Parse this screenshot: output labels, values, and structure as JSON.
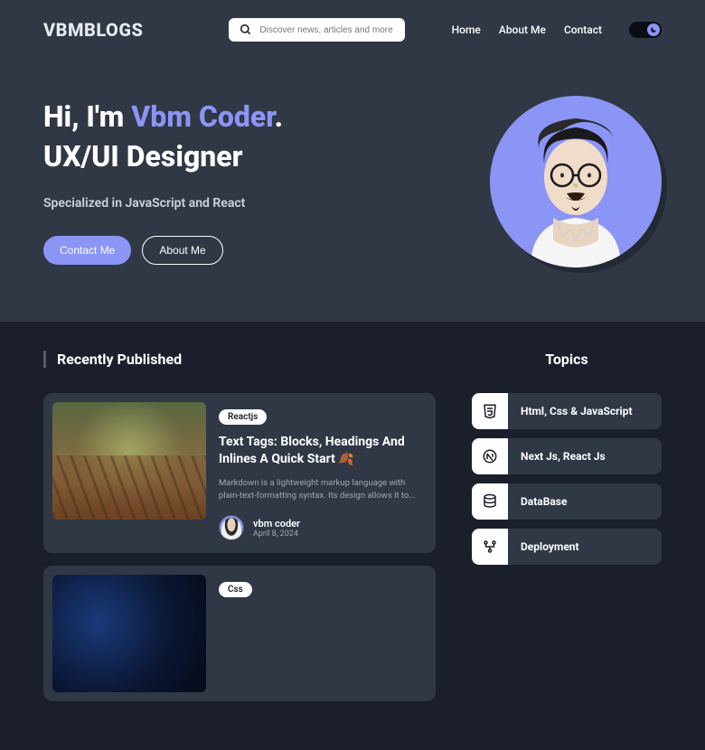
{
  "header": {
    "logo": "VBMBLOGS",
    "search_placeholder": "Discover news, articles and more",
    "nav": {
      "home": "Home",
      "about": "About Me",
      "contact": "Contact"
    }
  },
  "hero": {
    "greeting_prefix": "Hi, I'm ",
    "greeting_name": "Vbm Coder",
    "greeting_suffix": ".",
    "role": "UX/UI Designer",
    "subtitle": "Specialized in JavaScript and React",
    "btn_contact": "Contact Me",
    "btn_about": "About Me"
  },
  "sections": {
    "recently": "Recently Published",
    "topics": "Topics"
  },
  "posts": [
    {
      "tag": "Reactjs",
      "title": "Text Tags: Blocks, Headings And Inlines A Quick Start 🍂",
      "desc": "Markdown is a lightweight markup language with plain-text-formatting syntax. Its design allows it to...",
      "author": "vbm coder",
      "date": "April 8, 2024"
    },
    {
      "tag": "Css"
    }
  ],
  "topics": [
    {
      "label": "Html, Css & JavaScript"
    },
    {
      "label": "Next Js, React Js"
    },
    {
      "label": "DataBase"
    },
    {
      "label": "Deployment"
    }
  ]
}
